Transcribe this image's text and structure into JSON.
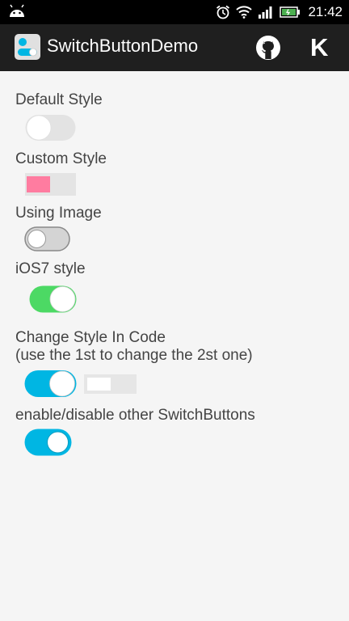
{
  "status_bar": {
    "time": "21:42",
    "icons": [
      "android-icon",
      "alarm-icon",
      "wifi-icon",
      "signal-icon",
      "battery-icon"
    ]
  },
  "app_bar": {
    "title": "SwitchButtonDemo",
    "actions": [
      "github-icon",
      "k-icon"
    ],
    "k_label": "K"
  },
  "sections": {
    "default_style": {
      "label": "Default Style",
      "checked": false
    },
    "custom_style": {
      "label": "Custom Style",
      "checked": false,
      "accent": "#ff7ca0"
    },
    "using_image": {
      "label": "Using Image",
      "checked": false
    },
    "ios7_style": {
      "label": "iOS7 style",
      "checked": true,
      "accent": "#4cd964"
    },
    "change_style": {
      "label_line1": "Change Style In Code",
      "label_line2": "(use the 1st to change the 2st one)",
      "first_checked": true,
      "second_checked": false,
      "accent": "#00b6e3"
    },
    "enable_disable": {
      "label": "enable/disable other SwitchButtons",
      "checked": true,
      "accent": "#00b6e3"
    }
  }
}
